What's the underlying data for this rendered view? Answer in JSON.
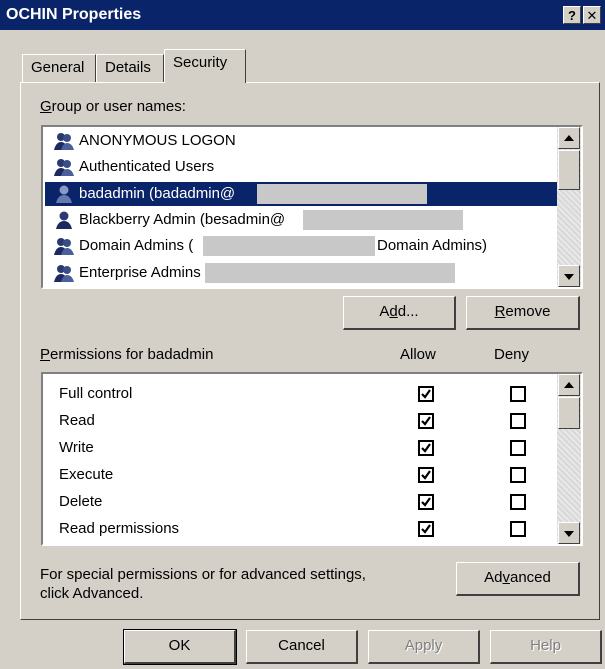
{
  "window": {
    "title": "OCHIN Properties",
    "help_glyph": "?",
    "close_glyph": "✕"
  },
  "tabs": [
    {
      "label": "General",
      "active": false
    },
    {
      "label": "Details",
      "active": false
    },
    {
      "label": "Security",
      "active": true
    }
  ],
  "users_section": {
    "label_prefix": "G",
    "label_rest": "roup or user names:",
    "users": [
      {
        "name": "ANONYMOUS LOGON",
        "selected": false
      },
      {
        "name": "Authenticated Users",
        "selected": false
      },
      {
        "name": "badadmin (badadmin@",
        "selected": true
      },
      {
        "name": "Blackberry Admin (besadmin@",
        "selected": false
      },
      {
        "name": "Domain Admins (",
        "suffix": "Domain Admins)",
        "selected": false
      },
      {
        "name": "Enterprise Admins",
        "selected": false
      }
    ],
    "add_button": {
      "before": "A",
      "ul": "d",
      "after": "d..."
    },
    "remove_button": {
      "ul": "R",
      "after": "emove"
    }
  },
  "permissions_section": {
    "label_prefix": "P",
    "label_rest": "ermissions for badadmin",
    "allow_header": "Allow",
    "deny_header": "Deny",
    "permissions": [
      {
        "name": "Full control",
        "allow": true,
        "deny": false
      },
      {
        "name": "Read",
        "allow": true,
        "deny": false
      },
      {
        "name": "Write",
        "allow": true,
        "deny": false
      },
      {
        "name": "Execute",
        "allow": true,
        "deny": false
      },
      {
        "name": "Delete",
        "allow": true,
        "deny": false
      },
      {
        "name": "Read permissions",
        "allow": true,
        "deny": false
      }
    ]
  },
  "advanced": {
    "text_line1": "For special permissions or for advanced settings,",
    "text_line2": "click Advanced.",
    "button": {
      "before": "Ad",
      "ul": "v",
      "after": "anced"
    }
  },
  "footer": {
    "ok": "OK",
    "cancel": "Cancel",
    "apply": "Apply",
    "help": "Help"
  },
  "colors": {
    "titlebar": "#0a246a",
    "selection": "#0a246a",
    "face": "#d4d0c8"
  }
}
